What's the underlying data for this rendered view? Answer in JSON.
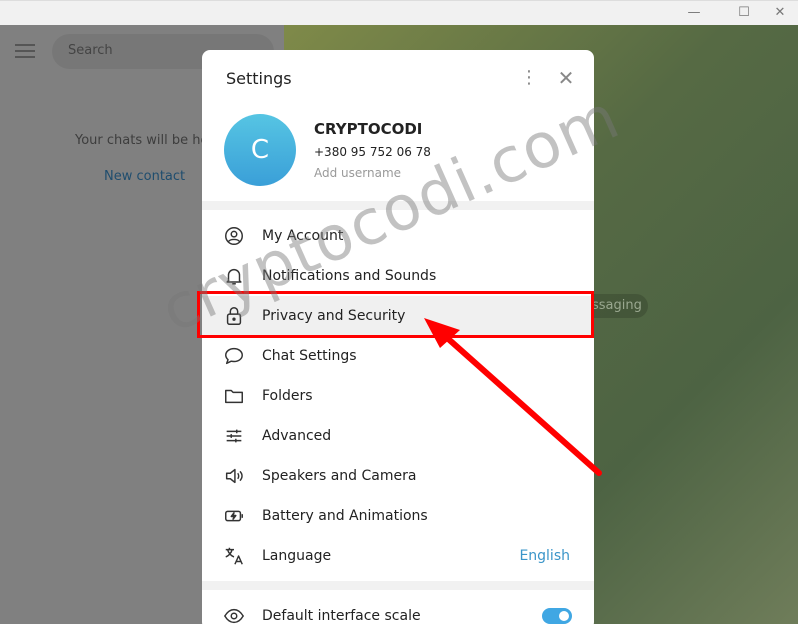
{
  "window": {
    "minimize": "—",
    "maximize": "☐",
    "close": "✕"
  },
  "sidebar": {
    "search_placeholder": "Search",
    "empty_text": "Your chats will be here",
    "new_contact": "New contact"
  },
  "chat": {
    "pill": "ssaging"
  },
  "settings": {
    "title": "Settings",
    "more": "⋮",
    "close": "✕",
    "profile": {
      "initial": "C",
      "name": "CRYPTOCODI",
      "phone": "+380 95 752 06 78",
      "username": "Add username"
    },
    "items": [
      {
        "label": "My Account",
        "icon": "user-circle-icon"
      },
      {
        "label": "Notifications and Sounds",
        "icon": "bell-icon"
      },
      {
        "label": "Privacy and Security",
        "icon": "lock-icon",
        "highlighted": true
      },
      {
        "label": "Chat Settings",
        "icon": "chat-bubble-icon"
      },
      {
        "label": "Folders",
        "icon": "folder-icon"
      },
      {
        "label": "Advanced",
        "icon": "sliders-icon"
      },
      {
        "label": "Speakers and Camera",
        "icon": "speaker-icon"
      },
      {
        "label": "Battery and Animations",
        "icon": "battery-icon"
      },
      {
        "label": "Language",
        "icon": "translate-icon",
        "value": "English"
      }
    ],
    "scale": {
      "label": "Default interface scale",
      "icon": "eye-icon",
      "enabled": true
    }
  },
  "annotation": {
    "watermark": "cryptocodi.com",
    "highlight_color": "#ff0000"
  },
  "colors": {
    "accent": "#40a7e3",
    "link": "#3a95c9"
  }
}
